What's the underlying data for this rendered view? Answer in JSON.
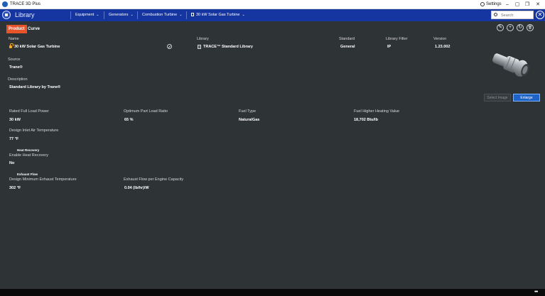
{
  "window": {
    "title": "TRACE 3D Plus",
    "settings_label": "Settings",
    "controls": {
      "minimize": "–",
      "maximize": "▢",
      "restore": "❐",
      "close": "✕"
    }
  },
  "nav": {
    "title": "Library",
    "breadcrumbs": [
      {
        "label": "Equipment"
      },
      {
        "label": "Generators"
      },
      {
        "label": "Combustion Turbine"
      },
      {
        "label": "30 kW Solar Gas Turbine"
      }
    ],
    "search_placeholder": "Search",
    "close_glyph": "✕"
  },
  "tabs": {
    "product": "Product",
    "curve": "Curve"
  },
  "header": {
    "name_label": "Name",
    "name_value": "30 kW Solar Gas Turbine",
    "library_label": "Library",
    "library_value": "TRACE™ Standard Library",
    "standard_label": "Standard",
    "standard_value": "General",
    "filter_label": "Library Filter",
    "filter_value": "IP",
    "version_label": "Version",
    "version_value": "1.23.002"
  },
  "toolbar": {
    "edit": "✎",
    "add": "+",
    "refresh": "↻",
    "delete": "🗑"
  },
  "source": {
    "label": "Source",
    "value": "Trane®"
  },
  "description": {
    "label": "Description",
    "value": "Standard Library by Trane®"
  },
  "image_buttons": {
    "select_image": "Select Image",
    "enlarge": "Enlarge"
  },
  "properties": {
    "rated_power_label": "Rated Full Load Power",
    "rated_power_value": "30 kW",
    "part_load_label": "Optimum Part Load Ratio",
    "part_load_value": "65 %",
    "fuel_type_label": "Fuel Type",
    "fuel_type_value": "NaturalGas",
    "heating_value_label": "Fuel Higher Heating Value",
    "heating_value_value": "18,702 Btu/lb",
    "inlet_temp_label": "Design Inlet Air Temperature",
    "inlet_temp_value": "77 °F",
    "heat_recovery_heading": "Heat Recovery",
    "enable_hr_label": "Enable Heat Recovery",
    "enable_hr_value": "No",
    "exhaust_heading": "Exhaust Flow",
    "exhaust_temp_label": "Design Minimum Exhaust Temperature",
    "exhaust_temp_value": "302 °F",
    "exhaust_flow_label": "Exhaust Flow per Engine Capacity",
    "exhaust_flow_value": "0.04 (lb/hr)/W"
  },
  "status": {
    "more": "•••"
  }
}
